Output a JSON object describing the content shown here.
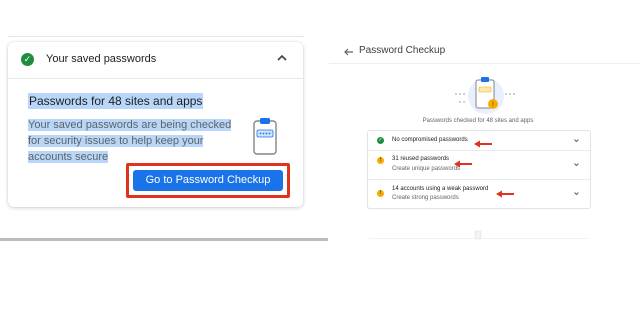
{
  "left_card": {
    "header_title": "Your saved passwords",
    "body_title": "Passwords for 48 sites and apps",
    "body_description": "Your saved passwords are being checked for security issues to help keep your accounts secure",
    "cta_label": "Go to Password Checkup",
    "icons": [
      "check-circle-icon",
      "chevron-up-icon",
      "clipboard-password-icon"
    ]
  },
  "right_page": {
    "title": "Password Checkup",
    "subcaption": "Passwords checked for 48 sites and apps",
    "rows": [
      {
        "title": "No compromised passwords",
        "subtitle": "",
        "status": "ok"
      },
      {
        "title": "31 reused passwords",
        "subtitle": "Create unique passwords",
        "status": "warning"
      },
      {
        "title": "14 accounts using a weak password",
        "subtitle": "Create strong passwords",
        "status": "warning"
      }
    ],
    "icons": [
      "back-arrow-icon",
      "clipboard-illustration",
      "chevron-down-icon",
      "red-arrow-annotation"
    ]
  },
  "colors": {
    "accent_blue": "#1a73e8",
    "success_green": "#1e8e3e",
    "warning_yellow": "#f9ab00",
    "annotation_red": "#e0321f",
    "selection_highlight": "#b8d6f8"
  }
}
